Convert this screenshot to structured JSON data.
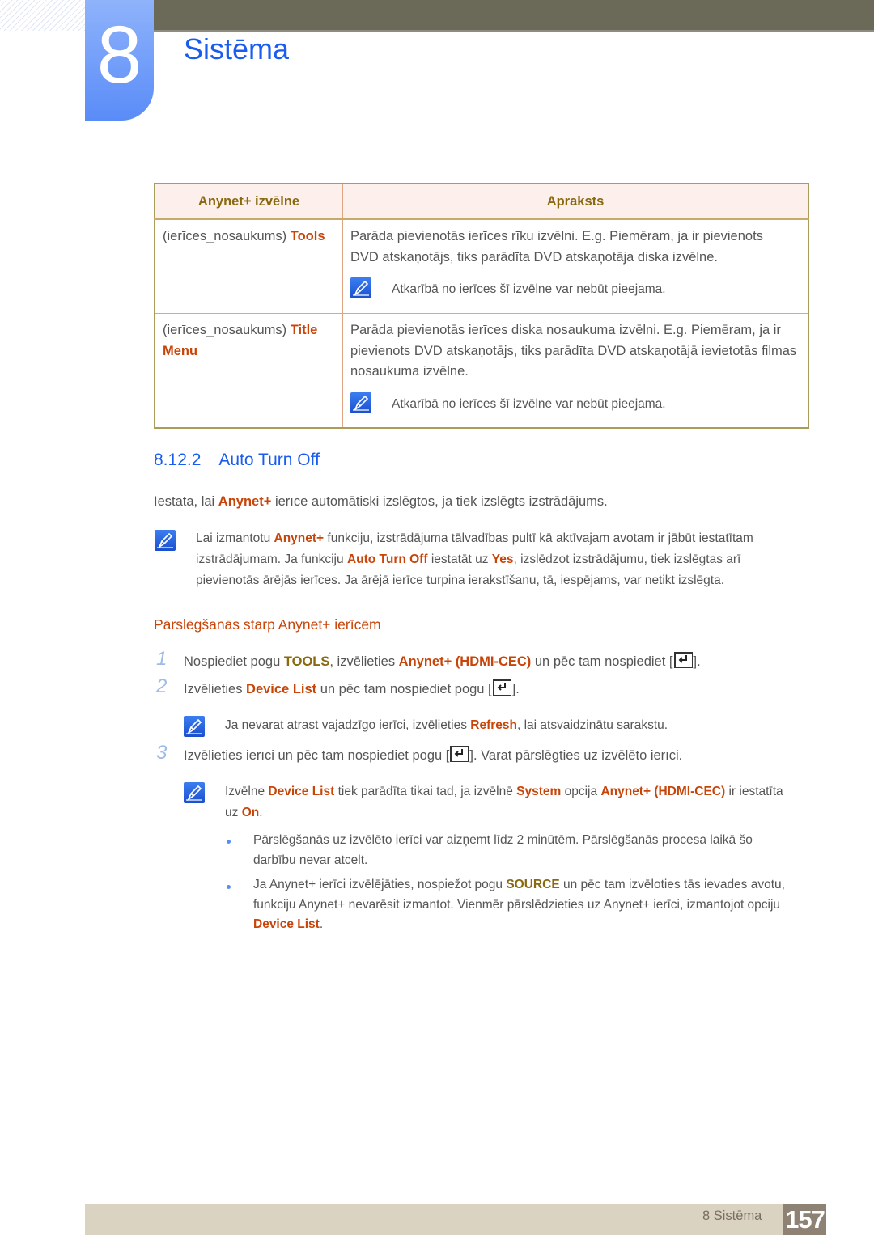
{
  "chapter": {
    "number": "8",
    "title": "Sistēma"
  },
  "table": {
    "headers": [
      "Anynet+ izvēlne",
      "Apraksts"
    ],
    "rows": [
      {
        "menu_prefix": "(ierīces_nosaukums)",
        "menu_name": "Tools",
        "menu_name_2": "",
        "description": "Parāda pievienotās ierīces rīku izvēlni. E.g. Piemēram, ja ir pievienots DVD atskaņotājs, tiks parādīta DVD atskaņotāja diska izvēlne.",
        "note": "Atkarībā no ierīces šī izvēlne var nebūt pieejama."
      },
      {
        "menu_prefix": "(ierīces_nosaukums)",
        "menu_name": "Title",
        "menu_name_2": "Menu",
        "description": "Parāda pievienotās ierīces diska nosaukuma izvēlni. E.g. Piemēram, ja ir pievienots DVD atskaņotājs, tiks parādīta DVD atskaņotājā ievietotās filmas nosaukuma izvēlne.",
        "note": "Atkarībā no ierīces šī izvēlne var nebūt pieejama."
      }
    ]
  },
  "section": {
    "number": "8.12.2",
    "title": "Auto Turn Off",
    "intro": {
      "a": "Iestata, lai ",
      "hl": "Anynet+",
      "b": " ierīce automātiski izslēgtos, ja tiek izslēgts izstrādājums."
    },
    "note": {
      "a": "Lai izmantotu ",
      "hl1": "Anynet+",
      "b": " funkciju, izstrādājuma tālvadības pultī kā aktīvajam avotam ir jābūt iestatītam izstrādājumam. Ja funkciju ",
      "hl2": "Auto Turn Off",
      "c": " iestatāt uz ",
      "hl3": "Yes",
      "d": ", izslēdzot izstrādājumu, tiek izslēgtas arī pievienotās ārējās ierīces. Ja ārējā ierīce turpina ierakstīšanu, tā, iespējams, var netikt izslēgta."
    }
  },
  "subsection": {
    "title": "Pārslēgšanās starp Anynet+ ierīcēm",
    "steps": [
      {
        "num": "1",
        "a": "Nospiediet pogu ",
        "hl1": "TOOLS",
        "b": ", izvēlieties ",
        "hl2": "Anynet+ (HDMI-CEC)",
        "c": " un pēc tam nospiediet [",
        "d": "]."
      },
      {
        "num": "2",
        "a": "Izvēlieties ",
        "hl1": "Device List",
        "b": " un pēc tam nospiediet pogu [",
        "c": "]."
      },
      {
        "num": "3",
        "a": "Izvēlieties ierīci un pēc tam nospiediet pogu [",
        "b": "]. Varat pārslēgties uz izvēlēto ierīci."
      }
    ],
    "note_refresh": {
      "a": "Ja nevarat atrast vajadzīgo ierīci, izvēlieties ",
      "hl": "Refresh",
      "b": ", lai atsvaidzinātu sarakstu."
    },
    "note_device_list": {
      "a": "Izvēlne ",
      "hl1": "Device List",
      "b": " tiek parādīta tikai tad, ja izvēlnē ",
      "hl2": "System",
      "c": " opcija ",
      "hl3": "Anynet+ (HDMI-CEC)",
      "d": " ir iestatīta uz ",
      "hl4": "On",
      "e": "."
    },
    "bullets": [
      {
        "text": "Pārslēgšanās uz izvēlēto ierīci var aizņemt līdz 2 minūtēm. Pārslēgšanās procesa laikā šo darbību nevar atcelt."
      },
      {
        "a": "Ja Anynet+ ierīci izvēlējāties, nospiežot pogu ",
        "hl1": "SOURCE",
        "b": " un pēc tam izvēloties tās ievades avotu, funkciju Anynet+ nevarēsit izmantot. Vienmēr pārslēdzieties uz Anynet+ ierīci, izmantojot opciju ",
        "hl2": "Device List",
        "c": "."
      }
    ]
  },
  "footer": {
    "label": "8 Sistēma",
    "page": "157"
  },
  "colors": {
    "accent_blue": "#1a5cf0",
    "highlight_red": "#c8450a",
    "highlight_olive": "#8a6a10"
  }
}
